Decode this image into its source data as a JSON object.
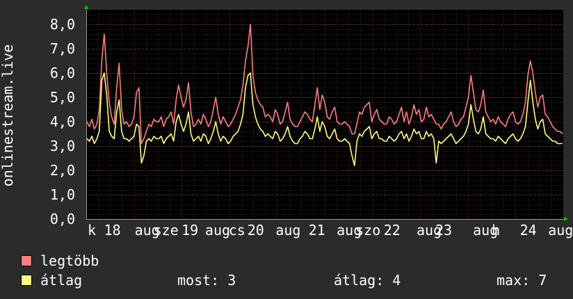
{
  "chart_data": {
    "type": "line",
    "ylabel": "onlinestream.live",
    "ylim": [
      0,
      8.6
    ],
    "yticks": [
      "0,0",
      "1,0",
      "2,0",
      "3,0",
      "4,0",
      "5,0",
      "6,0",
      "7,0",
      "8,0"
    ],
    "xticks": [
      {
        "label": "k",
        "at": 0.0
      },
      {
        "label": "18",
        "at": 0.35
      },
      {
        "label": "aug",
        "at": 1.0
      },
      {
        "label": "sze",
        "at": 1.4
      },
      {
        "label": "19",
        "at": 2.0
      },
      {
        "label": "aug",
        "at": 2.5
      },
      {
        "label": "cs",
        "at": 3.0
      },
      {
        "label": "20",
        "at": 3.4
      },
      {
        "label": "aug",
        "at": 4.0
      },
      {
        "label": "21",
        "at": 4.7
      },
      {
        "label": "aug",
        "at": 5.3
      },
      {
        "label": "szo",
        "at": 5.7
      },
      {
        "label": "22",
        "at": 6.3
      },
      {
        "label": "aug",
        "at": 7.0
      },
      {
        "label": "23",
        "at": 7.4
      },
      {
        "label": "aug",
        "at": 8.2
      },
      {
        "label": "h",
        "at": 8.6
      },
      {
        "label": "24",
        "at": 9.2
      },
      {
        "label": "aug",
        "at": 9.8
      }
    ],
    "series": [
      {
        "name": "legtöbb",
        "color": "#ff7f7f",
        "values": [
          4.0,
          3.8,
          4.1,
          3.7,
          3.9,
          4.5,
          6.5,
          7.6,
          6.0,
          4.8,
          4.2,
          3.9,
          5.4,
          6.4,
          4.5,
          3.9,
          4.0,
          3.8,
          3.9,
          4.2,
          5.2,
          5.4,
          3.1,
          3.3,
          3.6,
          3.9,
          3.8,
          4.1,
          4.0,
          4.0,
          4.2,
          3.8,
          4.1,
          4.2,
          4.4,
          3.9,
          4.9,
          5.5,
          5.0,
          4.6,
          4.9,
          5.6,
          4.4,
          3.8,
          3.9,
          4.1,
          3.9,
          4.3,
          4.1,
          3.8,
          4.0,
          4.5,
          5.0,
          4.3,
          3.9,
          4.2,
          4.0,
          3.8,
          3.9,
          4.1,
          4.3,
          4.6,
          4.9,
          5.5,
          6.5,
          7.1,
          8.0,
          5.9,
          5.2,
          4.9,
          4.7,
          4.6,
          4.2,
          4.3,
          4.2,
          4.0,
          4.5,
          4.3,
          3.9,
          4.0,
          4.4,
          4.8,
          4.1,
          3.9,
          3.8,
          3.8,
          4.0,
          4.2,
          4.4,
          4.3,
          4.1,
          4.0,
          4.7,
          5.4,
          4.5,
          5.1,
          4.8,
          4.2,
          4.1,
          4.4,
          4.6,
          4.0,
          3.9,
          3.9,
          4.0,
          3.9,
          3.8,
          3.5,
          3.5,
          3.9,
          4.4,
          4.3,
          4.6,
          4.7,
          4.8,
          4.0,
          4.3,
          4.5,
          4.1,
          4.0,
          3.9,
          3.9,
          4.2,
          4.1,
          3.9,
          4.0,
          4.3,
          4.6,
          4.0,
          4.4,
          3.9,
          4.2,
          4.7,
          4.3,
          4.5,
          4.0,
          4.1,
          4.6,
          4.2,
          4.3,
          4.1,
          3.9,
          3.9,
          3.7,
          3.9,
          4.0,
          4.2,
          4.4,
          4.0,
          3.8,
          3.9,
          4.1,
          4.2,
          4.6,
          5.0,
          5.9,
          5.2,
          4.5,
          4.4,
          4.7,
          5.3,
          4.4,
          4.2,
          4.0,
          4.1,
          3.9,
          4.2,
          4.0,
          3.9,
          3.8,
          4.1,
          4.3,
          4.4,
          4.0,
          3.9,
          4.0,
          4.3,
          4.8,
          5.9,
          6.5,
          6.0,
          5.2,
          4.6,
          5.0,
          5.1,
          4.3,
          4.2,
          4.0,
          3.8,
          3.7,
          3.6,
          3.6,
          3.5
        ]
      },
      {
        "name": "átlag",
        "color": "#ffff7f",
        "values": [
          3.3,
          3.2,
          3.4,
          3.1,
          3.3,
          3.6,
          5.7,
          6.0,
          5.1,
          3.6,
          3.4,
          3.3,
          4.4,
          4.9,
          3.6,
          3.3,
          3.3,
          3.2,
          3.3,
          3.4,
          3.9,
          3.8,
          2.3,
          2.6,
          3.2,
          3.3,
          3.2,
          3.4,
          3.3,
          3.3,
          3.4,
          3.1,
          3.3,
          3.4,
          3.5,
          3.2,
          4.0,
          4.3,
          3.9,
          3.6,
          3.9,
          4.4,
          3.5,
          3.2,
          3.3,
          3.4,
          3.2,
          3.5,
          3.4,
          3.1,
          3.3,
          3.6,
          4.0,
          3.5,
          3.2,
          3.4,
          3.3,
          3.1,
          3.2,
          3.4,
          3.5,
          3.6,
          3.9,
          4.3,
          5.4,
          5.9,
          6.0,
          4.7,
          4.2,
          3.9,
          3.7,
          3.6,
          3.4,
          3.5,
          3.4,
          3.3,
          3.6,
          3.5,
          3.2,
          3.3,
          3.5,
          3.8,
          3.4,
          3.2,
          3.1,
          3.1,
          3.3,
          3.4,
          3.6,
          3.5,
          3.3,
          3.3,
          3.7,
          4.2,
          3.6,
          4.0,
          3.8,
          3.4,
          3.3,
          3.5,
          3.7,
          3.3,
          3.2,
          3.2,
          3.3,
          3.2,
          3.1,
          2.6,
          2.2,
          3.2,
          3.5,
          3.4,
          3.6,
          3.7,
          3.8,
          3.3,
          3.5,
          3.6,
          3.3,
          3.3,
          3.2,
          3.2,
          3.4,
          3.3,
          3.2,
          3.3,
          3.5,
          3.6,
          3.3,
          3.5,
          3.2,
          3.4,
          3.7,
          3.5,
          3.6,
          3.3,
          3.3,
          3.6,
          3.4,
          3.5,
          3.3,
          2.3,
          3.2,
          3.1,
          3.2,
          3.3,
          3.4,
          3.5,
          3.3,
          3.1,
          3.2,
          3.3,
          3.4,
          3.6,
          3.9,
          4.7,
          4.1,
          3.6,
          3.5,
          3.7,
          4.2,
          3.5,
          3.4,
          3.3,
          3.3,
          3.2,
          3.4,
          3.3,
          3.2,
          3.1,
          3.3,
          3.4,
          3.5,
          3.3,
          3.2,
          3.3,
          3.5,
          3.8,
          4.8,
          5.7,
          4.8,
          4.1,
          3.7,
          4.0,
          4.1,
          3.5,
          3.4,
          3.3,
          3.2,
          3.2,
          3.1,
          3.1,
          3.1
        ]
      }
    ],
    "stats": {
      "most": "most: 3",
      "atlag": "átlag: 4",
      "max": "max: 7"
    }
  }
}
